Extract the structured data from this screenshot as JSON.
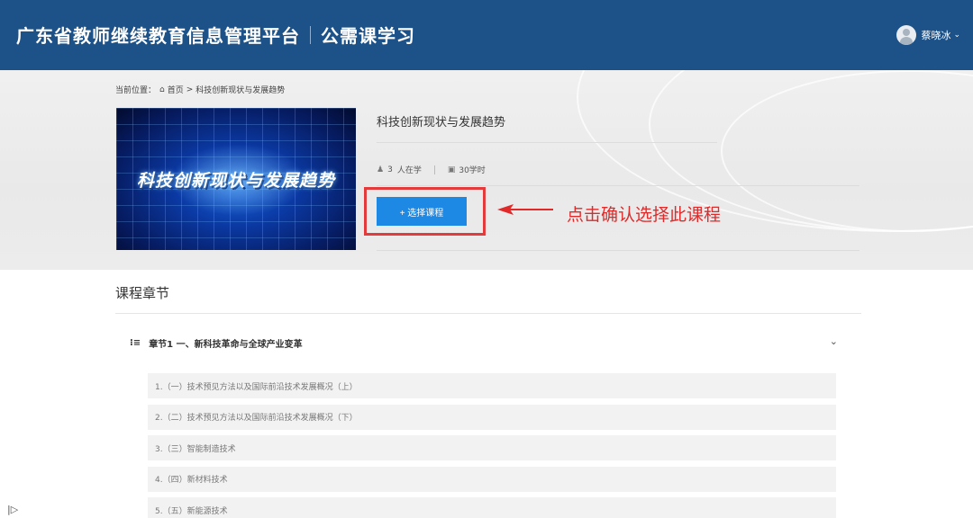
{
  "header": {
    "site_title": "广东省教师继续教育信息管理平台",
    "section_title": "公需课学习",
    "user_name": "蔡晓冰",
    "user_chevron": "⌄"
  },
  "breadcrumb": {
    "prefix": "当前位置：",
    "home_icon": "⌂",
    "home": "首页",
    "separator": ">",
    "current": "科技创新现状与发展趋势"
  },
  "course": {
    "cover_text": "科技创新现状与发展趋势",
    "title": "科技创新现状与发展趋势",
    "learners_icon": "♟",
    "learners_count": "3",
    "learners_label": "人在学",
    "hours_icon": "▣",
    "hours": "30学时",
    "select_button": "+ 选择课程"
  },
  "annotation": {
    "text": "点击确认选择此课程",
    "color": "#e02a2a"
  },
  "chapters": {
    "section_title": "课程章节",
    "list_icon": "⁝≡",
    "items": [
      {
        "label": "章节1  一、新科技革命与全球产业变革",
        "chevron": "⌄",
        "lessons": [
          "1.（一）技术预见方法以及国际前沿技术发展概况（上）",
          "2.（二）技术预见方法以及国际前沿技术发展概况（下）",
          "3.（三）智能制造技术",
          "4.（四）新材料技术",
          "5.（五）新能源技术"
        ]
      }
    ]
  },
  "sidebar_toggle": "|▷",
  "colors": {
    "header_bg": "#1c5288",
    "button_bg": "#1e88e5",
    "highlight": "#e33b3b"
  }
}
